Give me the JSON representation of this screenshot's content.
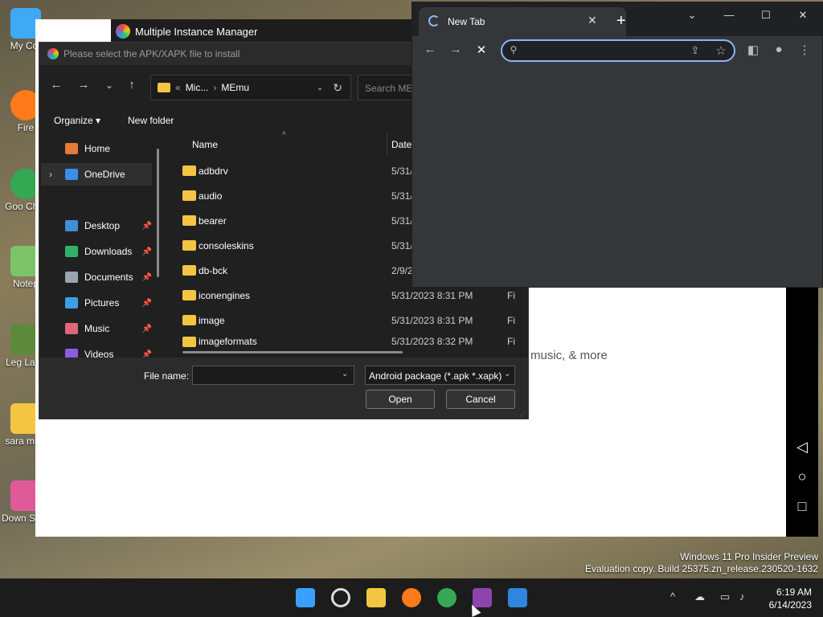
{
  "desktop": {
    "icons": [
      "My Cor",
      "Fire",
      "Goo Chro",
      "Notep",
      "Leg Laun",
      "sara miss",
      "Down Studio"
    ]
  },
  "memu": {
    "title": "Multiple Instance Manager",
    "body_text": "music, & more",
    "nav": {
      "back": "◁",
      "home": "○",
      "recent": "□"
    }
  },
  "dialog": {
    "title": "Please select the APK/XAPK file to install",
    "nav": {
      "back": "←",
      "forward": "→",
      "recent": "⌄",
      "up": "↑"
    },
    "address": {
      "prefix": "«",
      "segments": [
        "Mic...",
        "MEmu"
      ],
      "refresh": "↻"
    },
    "search_placeholder": "Search MEmu",
    "toolbar": {
      "organize": "Organize ▾",
      "new_folder": "New folder"
    },
    "nav_pane": [
      {
        "label": "Home",
        "color": "#e57b3a",
        "pinned": false,
        "expand": ""
      },
      {
        "label": "OneDrive",
        "color": "#3a8ee6",
        "pinned": false,
        "expand": "›"
      },
      {
        "label": "Desktop",
        "color": "#3f8fd6",
        "pinned": true,
        "expand": ""
      },
      {
        "label": "Downloads",
        "color": "#2fb36a",
        "pinned": true,
        "expand": ""
      },
      {
        "label": "Documents",
        "color": "#9aa4b2",
        "pinned": true,
        "expand": ""
      },
      {
        "label": "Pictures",
        "color": "#3aa0e6",
        "pinned": true,
        "expand": ""
      },
      {
        "label": "Music",
        "color": "#e0677a",
        "pinned": true,
        "expand": ""
      },
      {
        "label": "Videos",
        "color": "#8e5ce0",
        "pinned": true,
        "expand": ""
      }
    ],
    "columns": {
      "name": "Name",
      "date": "Date"
    },
    "files": [
      {
        "name": "adbdrv",
        "date": "5/31/",
        "type": ""
      },
      {
        "name": "audio",
        "date": "5/31/",
        "type": ""
      },
      {
        "name": "bearer",
        "date": "5/31/",
        "type": ""
      },
      {
        "name": "consoleskins",
        "date": "5/31/",
        "type": ""
      },
      {
        "name": "db-bck",
        "date": "2/9/2",
        "type": ""
      },
      {
        "name": "iconengines",
        "date": "5/31/2023 8:31 PM",
        "type": "Fi"
      },
      {
        "name": "image",
        "date": "5/31/2023 8:31 PM",
        "type": "Fi"
      },
      {
        "name": "imageformats",
        "date": "5/31/2023 8:32 PM",
        "type": "Fi"
      }
    ],
    "file_name_label": "File name:",
    "file_name_value": "",
    "filter": "Android package (*.apk *.xapk)",
    "open_label": "Open",
    "cancel_label": "Cancel"
  },
  "chrome": {
    "tab_title": "New Tab",
    "tab_close": "✕",
    "new_tab": "+",
    "controls": {
      "list": "⌄",
      "minimize": "—",
      "maximize": "☐",
      "close": "✕"
    },
    "omnibox_value": ""
  },
  "watermark": {
    "line1": "Windows 11 Pro Insider Preview",
    "line2": "Evaluation copy. Build 25375.zn_release.230520-1632"
  },
  "taskbar": {
    "time": "6:19 AM",
    "date": "6/14/2023",
    "tray_chevron": "^",
    "colors": {
      "start": "#3aa0ff",
      "explorer": "#f4c542",
      "firefox": "#ff7a1a",
      "chrome": "#34a853",
      "memu": "#8e44ad",
      "memu2": "#2e86de"
    }
  }
}
